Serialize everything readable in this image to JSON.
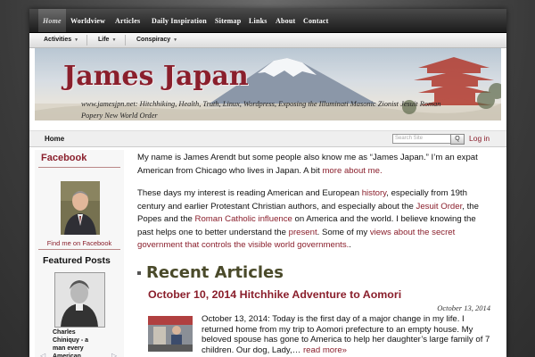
{
  "topnav": {
    "items": [
      "Home",
      "Worldview",
      "Articles",
      "Daily Inspiration",
      "Sitemap",
      "Links",
      "About",
      "Contact"
    ]
  },
  "subnav": {
    "items": [
      "Activities",
      "Life",
      "Conspiracy"
    ]
  },
  "header": {
    "title": "James Japan",
    "tagline": "www.jamesjpn.net: Hitchhiking, Health, Truth, Linux, Wordpress, Exposing the Illuminati Masonic Zionist Jesuit Roman Popery New World Order"
  },
  "breadcrumb": {
    "home": "Home"
  },
  "search": {
    "placeholder": "Search Site",
    "button": "Q"
  },
  "login": "Log in",
  "sidebar": {
    "facebook_title": "Facebook",
    "facebook_link": "Find me on Facebook",
    "featured_title": "Featured Posts",
    "featured_caption": "Charles Chiniquy - a man every American should know",
    "prev": "◁",
    "next": "▷"
  },
  "intro": {
    "p1_a": "My name is James Arendt but some people also know me as “James Japan.” I’m an expat American from Chicago who lives in Japan. A bit ",
    "p1_link": "more about me.",
    "p2_a": "These days my interest is reading American and European ",
    "p2_link1": "history",
    "p2_b": ", especially from 19th century and earlier Protestant Christian authors, and especially about the ",
    "p2_link2": "Jesuit Order",
    "p2_c": ", the Popes and the ",
    "p2_link3": "Roman Catholic influence",
    "p2_d": " on America and the world. I believe knowing the past helps one to better understand the ",
    "p2_link4": "present",
    "p2_e": ". Some of my ",
    "p2_link5": "views about the secret government that controls the visible world governments.",
    "p2_f": "."
  },
  "recent": {
    "heading": "Recent Articles",
    "post_title": "October 10, 2014 Hitchhike Adventure to Aomori",
    "post_date": "October 13, 2014",
    "post_excerpt": "October 13, 2014: Today is the first day of a major change in my life. I returned home from my trip to Aomori prefecture to an empty house. My beloved spouse has gone to America to help her daughter’s large family of 7 children. Our dog, Lady,… ",
    "read_more": "read more»"
  },
  "colors": {
    "accent": "#8a1f2c",
    "nav": "#1c1c1c"
  }
}
